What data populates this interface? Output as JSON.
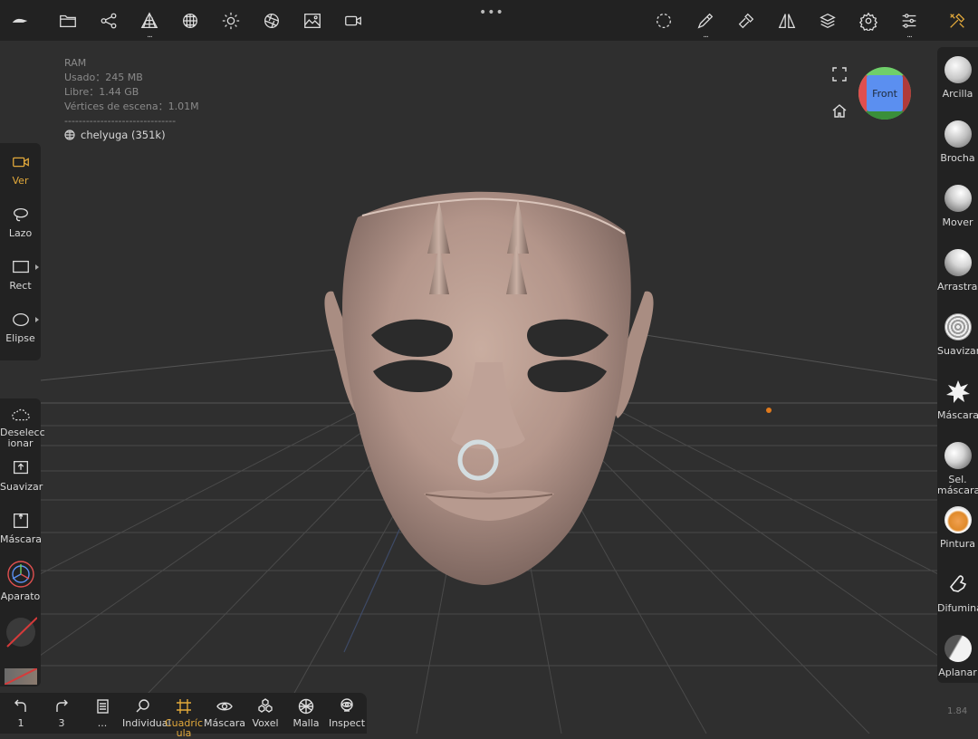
{
  "top_toolbar": {
    "left_icons": [
      "nomad-logo-icon",
      "folder-icon",
      "scene-graph-icon",
      "topology-icon",
      "material-sphere-icon",
      "light-icon",
      "camera-lens-icon",
      "image-icon",
      "video-icon"
    ],
    "right_icons": [
      "selection-circle-icon",
      "brush-icon",
      "hammer-icon",
      "symmetry-icon",
      "layers-icon",
      "settings-icon",
      "sliders-icon",
      "tools-icon"
    ]
  },
  "stats": {
    "ram_label": "RAM",
    "used": "Usado：245 MB",
    "free": "Libre：1.44 GB",
    "vertices": "Vértices de escena：1.01M",
    "separator": "-------------------------------"
  },
  "mesh": {
    "name": "chelyuga (351k)"
  },
  "view_gizmo": {
    "label": "Front",
    "colors": {
      "front": "#5b8ff0",
      "left": "#e04f4f",
      "top": "#6fcf6a",
      "right": "#b03a3a",
      "bottom": "#3a8f3a"
    }
  },
  "left_tools_top": [
    {
      "label": "Ver",
      "icon": "camera-icon",
      "active": true
    },
    {
      "label": "Lazo",
      "icon": "lasso-icon",
      "active": false
    },
    {
      "label": "Rect",
      "icon": "rectangle-icon",
      "active": false
    },
    {
      "label": "Elipse",
      "icon": "ellipse-icon",
      "active": false
    }
  ],
  "left_tools_bottom": [
    {
      "label": "Deseleccionar",
      "line1": "Deselecc",
      "line2": "ionar",
      "icon": "cloud-dashed-icon"
    },
    {
      "label": "Suavizar",
      "icon": "smooth-box-icon"
    },
    {
      "label": "Máscara",
      "icon": "mask-box-icon"
    },
    {
      "label": "Aparato",
      "icon": "gizmo-icon"
    }
  ],
  "right_tools": [
    {
      "label": "Arcilla",
      "line2": ""
    },
    {
      "label": "Brocha",
      "line2": ""
    },
    {
      "label": "Mover",
      "line2": ""
    },
    {
      "label": "Arrastrar",
      "line2": ""
    },
    {
      "label": "Suavizar",
      "line2": ""
    },
    {
      "label": "Máscara",
      "line2": ""
    },
    {
      "label": "Sel.",
      "line2": "máscara"
    },
    {
      "label": "Pintura",
      "line2": ""
    },
    {
      "label": "Difuminar",
      "line2": ""
    },
    {
      "label": "Aplanar",
      "line2": ""
    }
  ],
  "bottom_tools": [
    {
      "label": "1",
      "icon": "undo-icon"
    },
    {
      "label": "3",
      "icon": "redo-icon"
    },
    {
      "label": "...",
      "icon": "book-icon"
    },
    {
      "label": "Individual",
      "icon": "magnifier-icon"
    },
    {
      "label": "Cuadrícula",
      "line1": "Cuadríc",
      "line2": "ula",
      "icon": "grid-icon",
      "active": true
    },
    {
      "label": "Máscara",
      "icon": "eye-icon"
    },
    {
      "label": "Voxel",
      "icon": "voxel-icon"
    },
    {
      "label": "Malla",
      "icon": "mesh-icon"
    },
    {
      "label": "Inspect",
      "icon": "inspect-icon"
    }
  ],
  "version": "1.84",
  "accent_color": "#e2a93b",
  "orange_dot_color": "#e07a1c"
}
